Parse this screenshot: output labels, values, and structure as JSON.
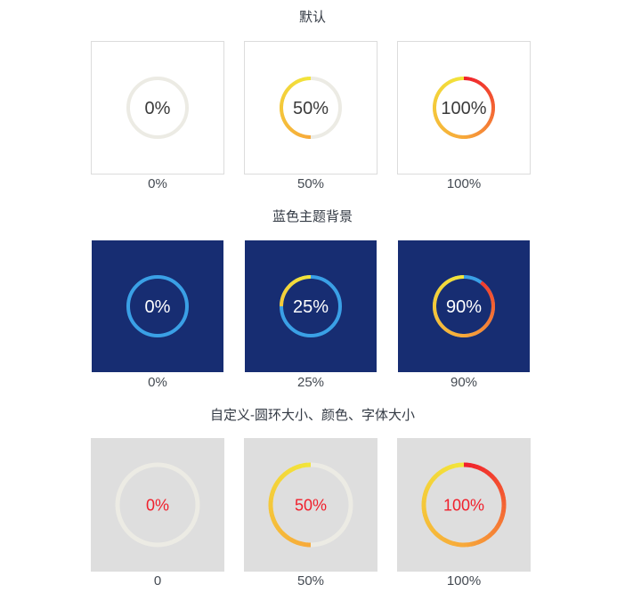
{
  "sections": [
    {
      "title": "默认",
      "theme": "default",
      "items": [
        {
          "value": 0,
          "label": "0%",
          "caption": "0%"
        },
        {
          "value": 50,
          "label": "50%",
          "caption": "50%"
        },
        {
          "value": 100,
          "label": "100%",
          "caption": "100%"
        }
      ]
    },
    {
      "title": "蓝色主题背景",
      "theme": "blue",
      "items": [
        {
          "value": 0,
          "label": "0%",
          "caption": "0%"
        },
        {
          "value": 25,
          "label": "25%",
          "caption": "25%"
        },
        {
          "value": 90,
          "label": "90%",
          "caption": "90%"
        }
      ]
    },
    {
      "title": "自定义-圆环大小、颜色、字体大小",
      "theme": "custom",
      "items": [
        {
          "value": 0,
          "label": "0%",
          "caption": "0"
        },
        {
          "value": 50,
          "label": "50%",
          "caption": "50%"
        },
        {
          "value": 100,
          "label": "100%",
          "caption": "100%"
        }
      ]
    }
  ],
  "colors": {
    "track_light": "#ecebe4",
    "track_blue": "#3aa0e6",
    "gradient_start": "#f2e63a",
    "gradient_mid": "#f7a93a",
    "gradient_end": "#f01f2c",
    "text_default": "#3a3a3a",
    "text_blue": "#ffffff",
    "text_custom": "#f0202c",
    "blue_bg": "#172d72",
    "custom_bg": "#dedede"
  }
}
